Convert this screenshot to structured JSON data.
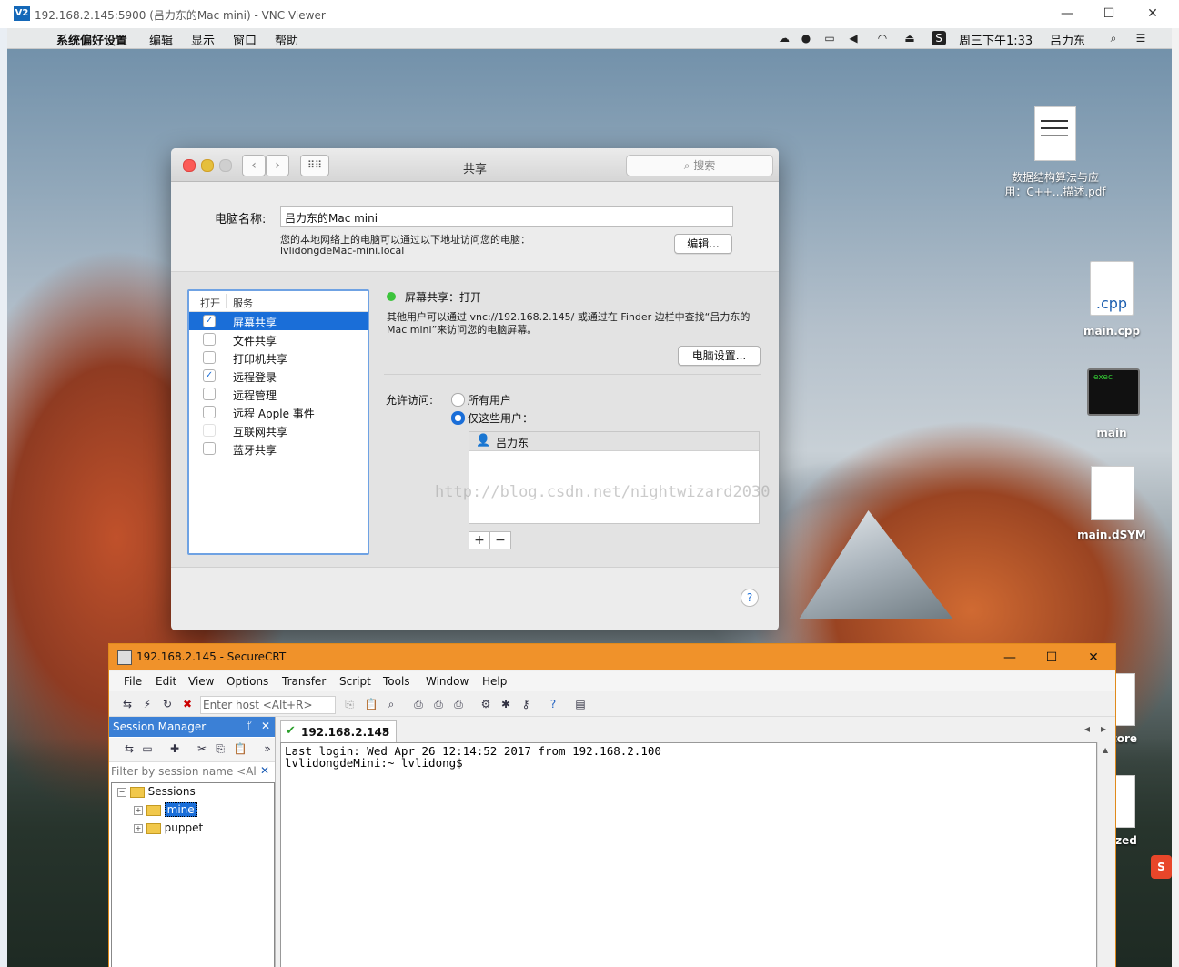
{
  "vnc": {
    "title": "192.168.2.145:5900 (吕力东的Mac mini) - VNC Viewer",
    "logo_text": "V2"
  },
  "mac_menubar": {
    "apple": "",
    "items": [
      "系统偏好设置",
      "编辑",
      "显示",
      "窗口",
      "帮助"
    ],
    "clock": "周三下午1:33",
    "user": "吕力东"
  },
  "desktop_icons": {
    "pdf": {
      "label_line1": "数据结构算法与应",
      "label_line2": "用：C++...描述.pdf"
    },
    "cpp": {
      "label": "main.cpp",
      "badge": ".cpp"
    },
    "exec": {
      "label": "main",
      "badge": "exec"
    },
    "dsym": {
      "label": "main.dSYM"
    },
    "partial1": {
      "label": "tore"
    },
    "partial2": {
      "label": "ized"
    }
  },
  "prefs": {
    "title": "共享",
    "search_placeholder": "搜索",
    "computer_name_label": "电脑名称:",
    "computer_name_value": "吕力东的Mac mini",
    "local_desc": "您的本地网络上的电脑可以通过以下地址访问您的电脑：",
    "local_address": "lvlidongdeMac-mini.local",
    "edit_button": "编辑...",
    "list_header_on": "打开",
    "list_header_service": "服务",
    "services": [
      {
        "label": "屏幕共享",
        "checked": true,
        "selected": true
      },
      {
        "label": "文件共享",
        "checked": false,
        "selected": false
      },
      {
        "label": "打印机共享",
        "checked": false,
        "selected": false
      },
      {
        "label": "远程登录",
        "checked": true,
        "selected": false
      },
      {
        "label": "远程管理",
        "checked": false,
        "selected": false
      },
      {
        "label": "远程 Apple 事件",
        "checked": false,
        "selected": false
      },
      {
        "label": "互联网共享",
        "checked": false,
        "selected": false
      },
      {
        "label": "蓝牙共享",
        "checked": false,
        "selected": false
      }
    ],
    "status_title": "屏幕共享：打开",
    "status_desc_line1": "其他用户可以通过 vnc://192.168.2.145/ 或通过在 Finder 边栏中查找“吕力东的",
    "status_desc_line2": "Mac mini”来访问您的电脑屏幕。",
    "computer_settings_button": "电脑设置...",
    "allow_access_label": "允许访问:",
    "option_all_users": "所有用户",
    "option_these_users": "仅这些用户：",
    "users": [
      "吕力东"
    ],
    "watermark": "http://blog.csdn.net/nightwizard2030",
    "add_button": "+",
    "remove_button": "−",
    "help_button": "?",
    "status_color": "#3cc43c"
  },
  "securecrt": {
    "title": "192.168.2.145 - SecureCRT",
    "menu": [
      "File",
      "Edit",
      "View",
      "Options",
      "Transfer",
      "Script",
      "Tools",
      "Window",
      "Help"
    ],
    "host_placeholder": "Enter host <Alt+R>",
    "session_manager_title": "Session Manager",
    "pin_icon": "ᛘ",
    "filter_placeholder": "Filter by session name <Alt+",
    "tree": {
      "root": "Sessions",
      "children": [
        "mine",
        "puppet"
      ]
    },
    "tab_label": "192.168.2.145",
    "terminal_lines": [
      "Last login: Wed Apr 26 12:14:52 2017 from 192.168.2.100",
      "lvlidongdeMini:~ lvlidong$"
    ],
    "title_bar_color": "#f0922a"
  }
}
